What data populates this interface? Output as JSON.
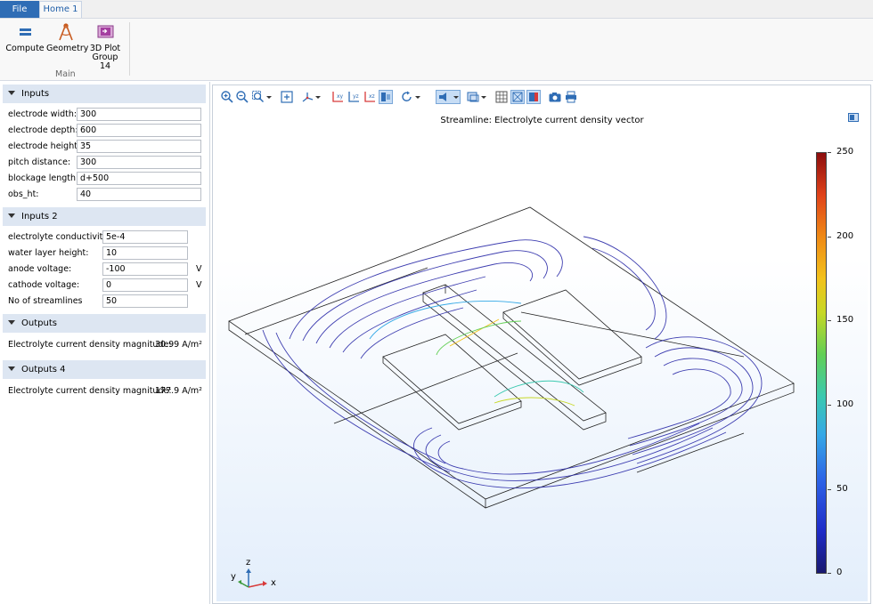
{
  "ribbon": {
    "tabs": [
      {
        "label": "File"
      },
      {
        "label": "Home 1"
      }
    ],
    "buttons": [
      {
        "label": "Compute"
      },
      {
        "label": "Geometry"
      },
      {
        "label": "3D Plot Group 14",
        "line1": "3D Plot",
        "line2": "Group 14"
      }
    ],
    "group_label": "Main"
  },
  "inputs": {
    "title": "Inputs",
    "fields": [
      {
        "label": "electrode width:",
        "value": "300"
      },
      {
        "label": "electrode depth:",
        "value": "600"
      },
      {
        "label": "electrode height:",
        "value": "35"
      },
      {
        "label": "pitch distance:",
        "value": "300"
      },
      {
        "label": "blockage length:",
        "value": "d+500"
      },
      {
        "label": "obs_ht:",
        "value": "40"
      }
    ]
  },
  "inputs2": {
    "title": "Inputs 2",
    "fields": [
      {
        "label": "electrolyte conductivity:",
        "value": "5e-4",
        "unit": ""
      },
      {
        "label": "water layer height:",
        "value": "10",
        "unit": ""
      },
      {
        "label": "anode voltage:",
        "value": "-100",
        "unit": "V"
      },
      {
        "label": "cathode voltage:",
        "value": "0",
        "unit": "V"
      },
      {
        "label": "No of streamlines",
        "value": "50",
        "unit": ""
      }
    ]
  },
  "outputs": {
    "title": "Outputs",
    "label": "Electrolyte current density magnitude:",
    "value": "30.99 A/m²"
  },
  "outputs4": {
    "title": "Outputs 4",
    "label": "Electrolyte current density magnitude:",
    "value": "177.9 A/m²"
  },
  "graphics": {
    "title": "Streamline: Electrolyte current density vector",
    "colorbar": {
      "min": 0,
      "max": 250,
      "ticks": [
        "250",
        "200",
        "150",
        "100",
        "50",
        "0"
      ]
    },
    "axes": {
      "x": "x",
      "y": "y",
      "z": "z"
    },
    "toolbar_icons": [
      "zoom-in-icon",
      "zoom-out-icon",
      "zoom-box-icon",
      "zoom-extents-icon",
      "axis-orient-icon",
      "view-xy-icon",
      "view-yz-icon",
      "view-xz-icon",
      "view-3d-icon",
      "rotate-icon",
      "light-icon",
      "transparency-icon",
      "grid-icon",
      "wireframe-icon",
      "render-icon",
      "camera-icon",
      "print-icon"
    ]
  }
}
